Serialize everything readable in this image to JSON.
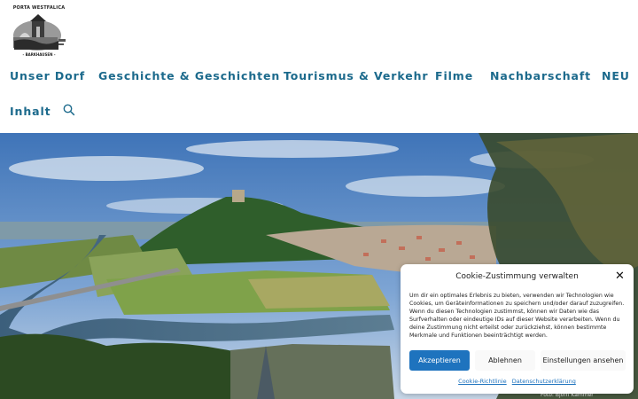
{
  "logo": {
    "top_text": "PORTA WESTFALICA",
    "bottom_text": "- BARKHAUSEN -"
  },
  "nav": {
    "items": [
      {
        "label": "Unser Dorf"
      },
      {
        "label": "Geschichte & Geschichten"
      },
      {
        "label": "Tourismus & Verkehr"
      },
      {
        "label": "Filme"
      },
      {
        "label": "Nachbarschaft"
      },
      {
        "label": "NEU"
      },
      {
        "label": "Inhalt"
      }
    ],
    "search_icon": "search-icon"
  },
  "hero": {
    "credit": "Foto: Björn Kämmer"
  },
  "cookie": {
    "title": "Cookie-Zustimmung verwalten",
    "body": "Um dir ein optimales Erlebnis zu bieten, verwenden wir Technologien wie Cookies, um Geräteinformationen zu speichern und/oder darauf zuzugreifen. Wenn du diesen Technologien zustimmst, können wir Daten wie das Surfverhalten oder eindeutige IDs auf dieser Website verarbeiten. Wenn du deine Zustimmung nicht erteilst oder zurückziehst, können bestimmte Merkmale und Funktionen beeinträchtigt werden.",
    "accept_label": "Akzeptieren",
    "deny_label": "Ablehnen",
    "settings_label": "Einstellungen ansehen",
    "link_policy": "Cookie-Richtlinie",
    "link_privacy": "Datenschutzerklärung",
    "accent_color": "#1e73be"
  },
  "colors": {
    "nav_text": "#1c6a8c"
  }
}
